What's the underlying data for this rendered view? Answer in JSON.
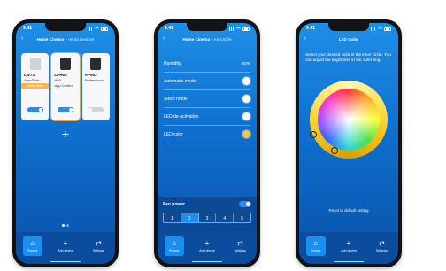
{
  "screens": [
    {
      "status_time": "9:41",
      "header_title": "Home Cinema",
      "header_sub": "- Venta Devices",
      "devices": [
        {
          "name": "LW73",
          "line2": "AeroStyle",
          "warning": "Water level",
          "line3": "",
          "on": true
        },
        {
          "name": "LPH60",
          "line2": "WiFi",
          "warning": "",
          "line3": "App Control",
          "on": true
        },
        {
          "name": "AP902",
          "line2": "Professional",
          "warning": "",
          "line3": "",
          "on": false
        }
      ],
      "tabs": [
        {
          "icon": "⌂",
          "label": "Rooms",
          "active": true
        },
        {
          "icon": "+",
          "label": "Add device",
          "active": false
        },
        {
          "icon": "⇄",
          "label": "Settings",
          "active": false
        }
      ]
    },
    {
      "status_time": "9:41",
      "header_title": "Home Cinema",
      "header_sub": "- AeroStyle",
      "rows": [
        {
          "label": "Humidity",
          "value": "50%"
        },
        {
          "label": "Automatic mode",
          "value": ""
        },
        {
          "label": "Sleep mode",
          "value": ""
        },
        {
          "label": "LED de-activation",
          "value": ""
        },
        {
          "label": "LED color",
          "value": ""
        }
      ],
      "fan_label": "Fan power",
      "speeds": [
        "1",
        "2",
        "3",
        "4",
        "5"
      ],
      "active_speed": "2",
      "tabs": [
        {
          "icon": "⌂",
          "label": "Rooms",
          "active": true
        },
        {
          "icon": "+",
          "label": "Add device",
          "active": false
        },
        {
          "icon": "⇄",
          "label": "Settings",
          "active": false
        }
      ]
    },
    {
      "status_time": "9:41",
      "header_title": "LED Color",
      "desc": "Select your desired color in the inner circle. You can adjust the brightness in the outer ring.",
      "reset": "Reset to default setting",
      "tabs": [
        {
          "icon": "⌂",
          "label": "Rooms",
          "active": true
        },
        {
          "icon": "+",
          "label": "Add device",
          "active": false
        },
        {
          "icon": "⇄",
          "label": "Settings",
          "active": false
        }
      ]
    }
  ],
  "colors": {
    "accent": "#1b8ef2",
    "warning": "#ffb44a",
    "led_color": "#f6c544"
  }
}
